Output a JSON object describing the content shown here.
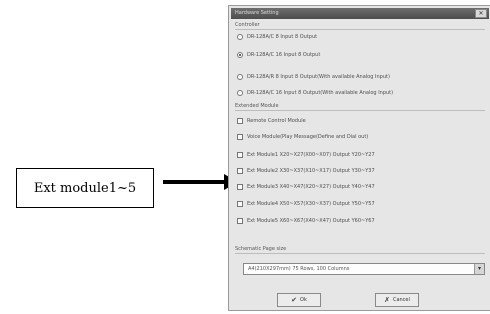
{
  "callout": {
    "label": "Ext module1~5"
  },
  "dialog": {
    "title": "Hardware Setting",
    "close_glyph": "✕",
    "controller": {
      "label": "Controller",
      "options": [
        {
          "label": "DR-128A/C 8 Input 8 Output",
          "checked": false
        },
        {
          "label": "DR-128A/C 16 Input 8 Output",
          "checked": true
        },
        {
          "label": "DR-128A/R 8 Input 8 Output(With available Analog Input)",
          "checked": false
        },
        {
          "label": "DR-128A/C 16 Input 8 Output(With available Analog Input)",
          "checked": false
        }
      ]
    },
    "extended": {
      "label": "Extended Module",
      "items": [
        {
          "label": "Remote Control Module"
        },
        {
          "label": "Voice Module(Play Message(Define and Dial out)"
        },
        {
          "label": "Ext Module1 X20~X27(X00~X07) Output Y20~Y27"
        },
        {
          "label": "Ext Module2 X30~X37(X10~X17) Output Y30~Y37"
        },
        {
          "label": "Ext Module3 X40~X47(X20~X27) Output Y40~Y47"
        },
        {
          "label": "Ext Module4 X50~X57(X30~X37) Output Y50~Y57"
        },
        {
          "label": "Ext Module5 X60~X67(X40~X47) Output Y60~Y67"
        }
      ]
    },
    "schematic": {
      "label": "Schematic Page size",
      "value": "A4(210X297mm) 75 Rows, 100 Columns"
    },
    "buttons": {
      "ok": "Ok",
      "cancel": "Cancel"
    }
  }
}
